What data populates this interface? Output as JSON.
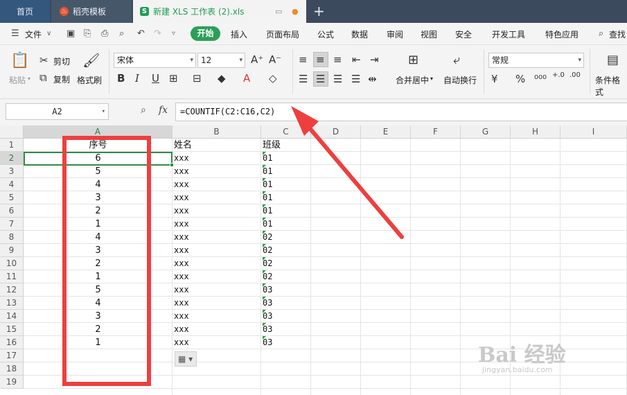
{
  "tabs": {
    "home": "首页",
    "template": "稻壳模板",
    "document": "新建 XLS 工作表 (2).xls"
  },
  "menu": {
    "file": "文件",
    "start": "开始",
    "items": [
      "插入",
      "页面布局",
      "公式",
      "数据",
      "审阅",
      "视图",
      "安全",
      "开发工具",
      "特色应用"
    ],
    "search": "查找"
  },
  "ribbon": {
    "paste": "粘贴",
    "cut": "剪切",
    "copy": "复制",
    "format_painter": "格式刷",
    "font_name": "宋体",
    "font_size": "12",
    "number_format": "常规",
    "merge_center": "合并居中",
    "wrap_text": "自动换行",
    "conditional_format": "条件格式"
  },
  "formula_bar": {
    "cell_ref": "A2",
    "fx": "fx",
    "formula": "=COUNTIF(C2:C16,C2)"
  },
  "sheet": {
    "columns": [
      "A",
      "B",
      "C",
      "D",
      "E",
      "F",
      "G",
      "H",
      "I"
    ],
    "rows": [
      "1",
      "2",
      "3",
      "4",
      "5",
      "6",
      "7",
      "8",
      "9",
      "10",
      "11",
      "12",
      "13",
      "14",
      "15",
      "16",
      "17",
      "18",
      "19"
    ],
    "headers": {
      "a": "序号",
      "b": "姓名",
      "c": "班级"
    },
    "serial": [
      "6",
      "5",
      "4",
      "3",
      "2",
      "1",
      "4",
      "3",
      "2",
      "1",
      "5",
      "4",
      "3",
      "2",
      "1"
    ],
    "names": [
      "xxx",
      "xxx",
      "xxx",
      "xxx",
      "xxx",
      "xxx",
      "xxx",
      "xxx",
      "xxx",
      "xxx",
      "xxx",
      "xxx",
      "xxx",
      "xxx",
      "xxx"
    ],
    "classes": [
      "01",
      "01",
      "01",
      "01",
      "01",
      "01",
      "02",
      "02",
      "02",
      "02",
      "03",
      "03",
      "03",
      "03",
      "03"
    ]
  },
  "colors": {
    "accent_green": "#2b9f57",
    "annotation_red": "#ee3f3f"
  },
  "watermark": {
    "main": "Bai 经验",
    "sub": "jingyan.baidu.com"
  }
}
